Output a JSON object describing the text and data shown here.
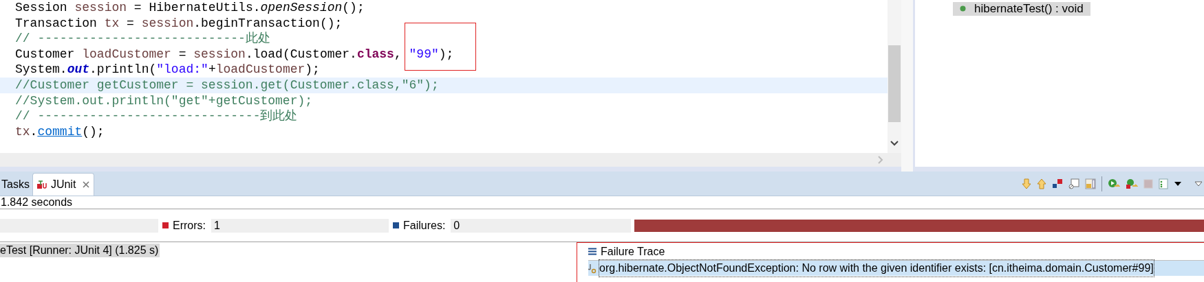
{
  "editor": {
    "lines": [
      {
        "current": false,
        "tokens": [
          {
            "kind": "plain",
            "text": "Session "
          },
          {
            "kind": "var",
            "text": "session"
          },
          {
            "kind": "plain",
            "text": " = HibernateUtils."
          },
          {
            "kind": "static",
            "text": "openSession"
          },
          {
            "kind": "plain",
            "text": "();"
          }
        ]
      },
      {
        "current": false,
        "tokens": [
          {
            "kind": "plain",
            "text": "Transaction "
          },
          {
            "kind": "var",
            "text": "tx"
          },
          {
            "kind": "plain",
            "text": " = "
          },
          {
            "kind": "var",
            "text": "session"
          },
          {
            "kind": "plain",
            "text": ".beginTransaction();"
          }
        ]
      },
      {
        "current": false,
        "tokens": [
          {
            "kind": "comment",
            "text": "// ----------------------------此处"
          }
        ]
      },
      {
        "current": false,
        "tokens": [
          {
            "kind": "plain",
            "text": "Customer "
          },
          {
            "kind": "var",
            "text": "loadCustomer"
          },
          {
            "kind": "plain",
            "text": " = "
          },
          {
            "kind": "var",
            "text": "session"
          },
          {
            "kind": "plain",
            "text": ".load(Customer."
          },
          {
            "kind": "keyword",
            "text": "class"
          },
          {
            "kind": "plain",
            "text": ", "
          },
          {
            "kind": "string",
            "text": "\"99\""
          },
          {
            "kind": "plain",
            "text": ");"
          }
        ]
      },
      {
        "current": false,
        "tokens": [
          {
            "kind": "plain",
            "text": "System."
          },
          {
            "kind": "field",
            "text": "out"
          },
          {
            "kind": "plain",
            "text": ".println("
          },
          {
            "kind": "string",
            "text": "\"load:\""
          },
          {
            "kind": "plain",
            "text": "+"
          },
          {
            "kind": "var",
            "text": "loadCustomer"
          },
          {
            "kind": "plain",
            "text": ");"
          }
        ]
      },
      {
        "current": true,
        "tokens": [
          {
            "kind": "comment",
            "text": "//Customer getCustomer = session.get(Customer.class,\"6\");"
          }
        ]
      },
      {
        "current": false,
        "tokens": [
          {
            "kind": "comment",
            "text": "//System.out.println(\"get\"+getCustomer);"
          }
        ]
      },
      {
        "current": false,
        "tokens": [
          {
            "kind": "comment",
            "text": "// ------------------------------到此处"
          }
        ]
      },
      {
        "current": false,
        "tokens": [
          {
            "kind": "var",
            "text": "tx"
          },
          {
            "kind": "plain",
            "text": "."
          },
          {
            "kind": "link",
            "text": "commit"
          },
          {
            "kind": "plain",
            "text": "();"
          }
        ]
      }
    ]
  },
  "outline": {
    "items": [
      {
        "label": "hibernateTest() : void",
        "selected": true
      }
    ]
  },
  "bottom_panel": {
    "tabs": [
      {
        "label": "Tasks",
        "selected": false,
        "closable": false
      },
      {
        "label": "JUnit",
        "selected": true,
        "closable": true
      }
    ],
    "elapsed": "1.842 seconds",
    "counters": [
      {
        "kind": "errors",
        "label": "Errors:",
        "value": "1"
      },
      {
        "kind": "failures",
        "label": "Failures:",
        "value": "0"
      }
    ],
    "progress": {
      "level": 1,
      "failed": true
    },
    "tree": [
      {
        "label": "eTest [Runner: JUnit 4] (1.825 s)",
        "selected": true
      }
    ],
    "failure_trace": {
      "title": "Failure Trace",
      "rows": [
        {
          "text": "org.hibernate.ObjectNotFoundException: No row with the given identifier exists: [cn.itheima.domain.Customer#99]",
          "selected": true
        }
      ]
    }
  }
}
